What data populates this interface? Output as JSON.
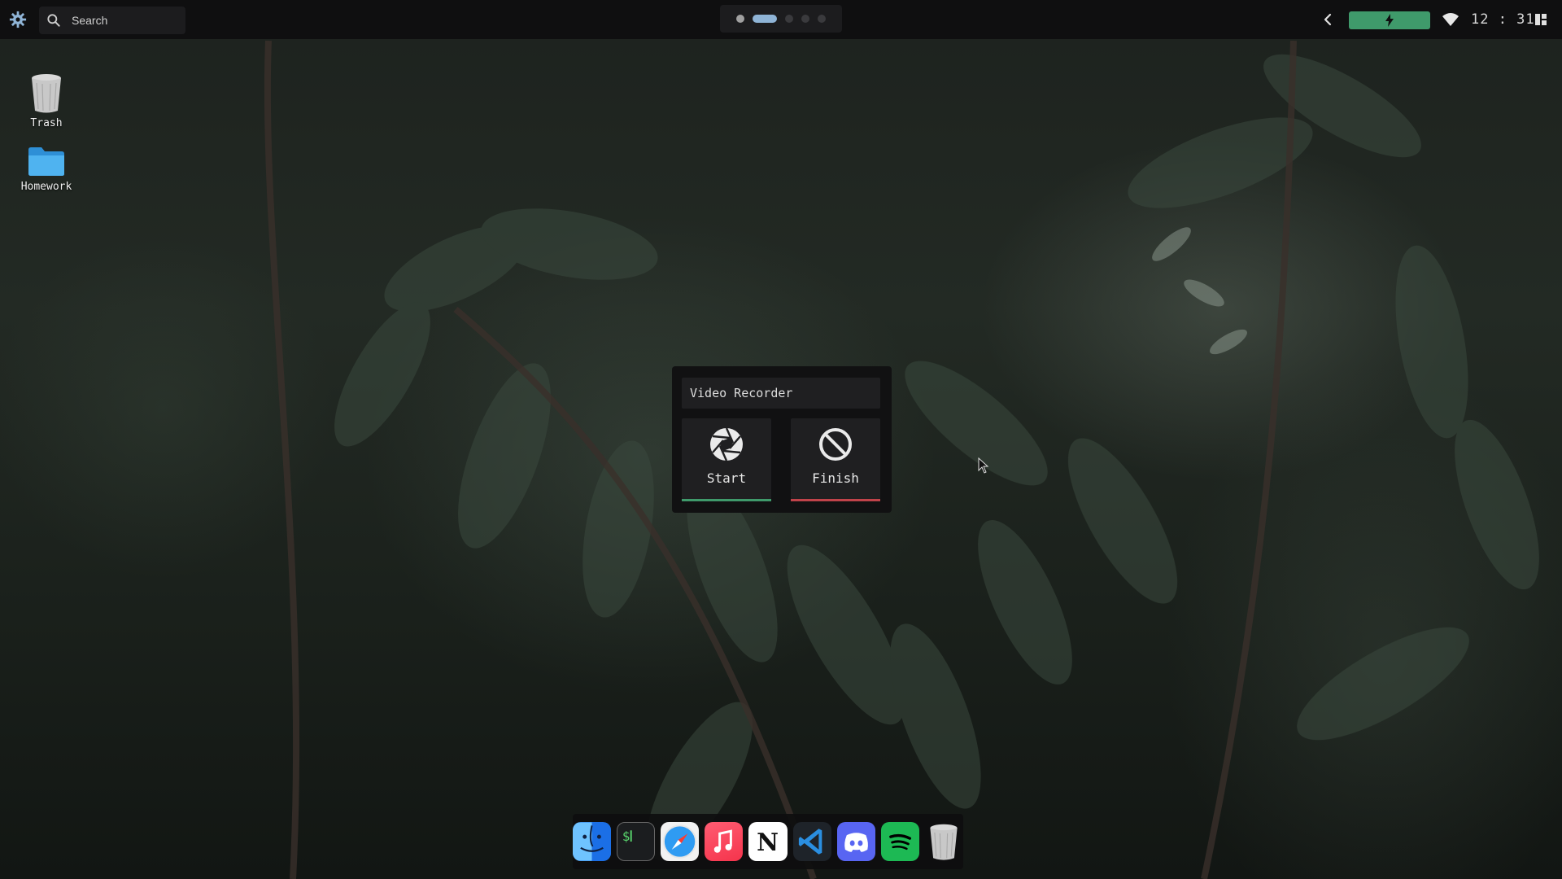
{
  "topbar": {
    "search": {
      "placeholder": "Search"
    },
    "workspaces": [
      {
        "state": "used"
      },
      {
        "state": "active"
      },
      {
        "state": "empty"
      },
      {
        "state": "empty"
      },
      {
        "state": "empty"
      }
    ],
    "battery": {
      "status": "charging",
      "color": "#3f9a6b"
    },
    "clock": "12 : 31"
  },
  "desktop": {
    "icons": [
      {
        "label": "Trash",
        "icon": "trash-icon"
      },
      {
        "label": "Homework",
        "icon": "folder-icon"
      }
    ]
  },
  "recorder": {
    "title": "Video Recorder",
    "start_label": "Start",
    "finish_label": "Finish",
    "start_color": "#3f9a6b",
    "finish_color": "#c0434a"
  },
  "dock": {
    "apps": [
      {
        "name": "finder",
        "icon": "finder-icon"
      },
      {
        "name": "terminal",
        "icon": "terminal-icon"
      },
      {
        "name": "safari",
        "icon": "safari-icon"
      },
      {
        "name": "music",
        "icon": "music-icon"
      },
      {
        "name": "notion",
        "icon": "notion-icon"
      },
      {
        "name": "vscode",
        "icon": "vscode-icon"
      },
      {
        "name": "discord",
        "icon": "discord-icon"
      },
      {
        "name": "spotify",
        "icon": "spotify-icon"
      },
      {
        "name": "trash",
        "icon": "trash-icon"
      }
    ]
  },
  "colors": {
    "panel": "#0f0f10",
    "widget": "#1f1f21",
    "workspace_active": "#8fb4d6"
  }
}
